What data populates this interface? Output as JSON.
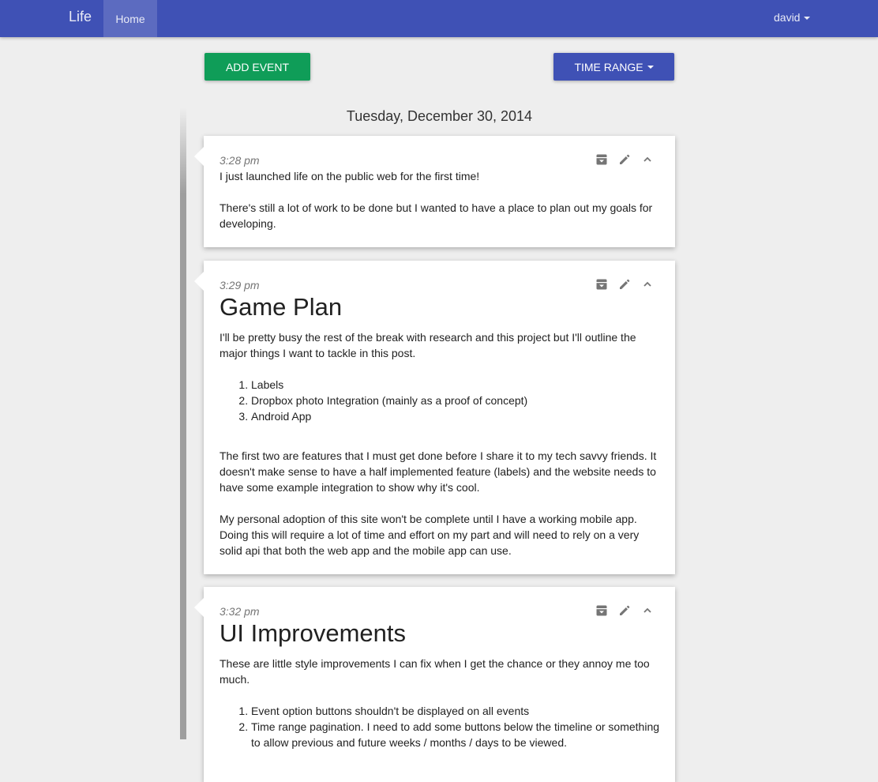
{
  "navbar": {
    "brand": "Life",
    "home": "Home",
    "user": "david"
  },
  "toolbar": {
    "add_event": "ADD EVENT",
    "time_range": "TIME RANGE"
  },
  "timeline": {
    "day": "Tuesday, December 30, 2014",
    "events": [
      {
        "time": "3:28 pm",
        "paragraphs": [
          "I just launched life on the public web for the first time!",
          "There's still a lot of work to be done but I wanted to have a place to plan out my goals for developing."
        ]
      },
      {
        "time": "3:29 pm",
        "title": "Game Plan",
        "intro": "I'll be pretty busy the rest of the break with research and this project but I'll outline the major things I want to tackle in this post.",
        "list": [
          "Labels",
          "Dropbox photo Integration (mainly as a proof of concept)",
          "Android App"
        ],
        "paragraphs": [
          "The first two are features that I must get done before I share it to my tech savvy friends. It doesn't make sense to have a half implemented feature (labels) and the website needs to have some example integration to show why it's cool.",
          "My personal adoption of this site won't be complete until I have a working mobile app. Doing this will require a lot of time and effort on my part and will need to rely on a very solid api that both the web app and the mobile app can use."
        ]
      },
      {
        "time": "3:32 pm",
        "title": "UI Improvements",
        "intro": "These are little style improvements I can fix when I get the chance or they annoy me too much.",
        "list": [
          "Event option buttons shouldn't be displayed on all events",
          "Time range pagination. I need to add some buttons below the timeline or something to allow previous and future weeks / months / days to be viewed."
        ]
      }
    ]
  },
  "icons": {
    "archive": "archive-icon",
    "edit": "pencil-icon",
    "collapse": "chevron-up-icon",
    "dropdown": "caret-down-icon"
  },
  "colors": {
    "navbar": "#3f51b5",
    "nav_active": "#5c6bc0",
    "add_button": "#0f9d58",
    "range_button": "#3f51b5",
    "background": "#eeeeee",
    "timeline": "#9e9e9e"
  }
}
